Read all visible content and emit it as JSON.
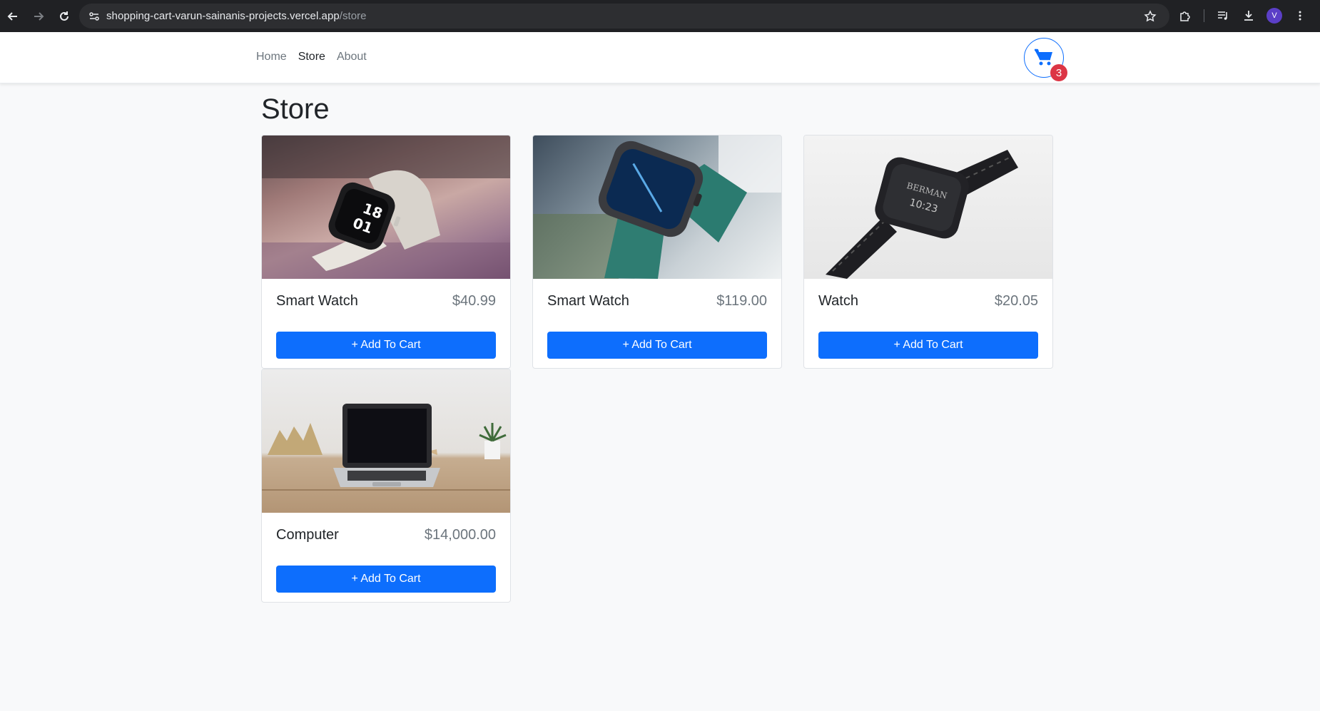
{
  "browser": {
    "url_host": "shopping-cart-varun-sainanis-projects.vercel.app",
    "url_path": "/store",
    "profile_initial": "V"
  },
  "navbar": {
    "links": [
      {
        "label": "Home",
        "active": false
      },
      {
        "label": "Store",
        "active": true
      },
      {
        "label": "About",
        "active": false
      }
    ],
    "cart_count": "3"
  },
  "page": {
    "title": "Store"
  },
  "products": [
    {
      "name": "Smart Watch",
      "price": "$40.99",
      "button": "+ Add To Cart",
      "image": "white-smart-watch"
    },
    {
      "name": "Smart Watch",
      "price": "$119.00",
      "button": "+ Add To Cart",
      "image": "green-strap-smart-watch"
    },
    {
      "name": "Watch",
      "price": "$20.05",
      "button": "+ Add To Cart",
      "image": "black-metal-watch"
    },
    {
      "name": "Computer",
      "price": "$14,000.00",
      "button": "+ Add To Cart",
      "image": "laptop-on-desk"
    }
  ],
  "colors": {
    "primary": "#0d6efd",
    "badge": "#dc3545",
    "background": "#f8f9fa"
  }
}
